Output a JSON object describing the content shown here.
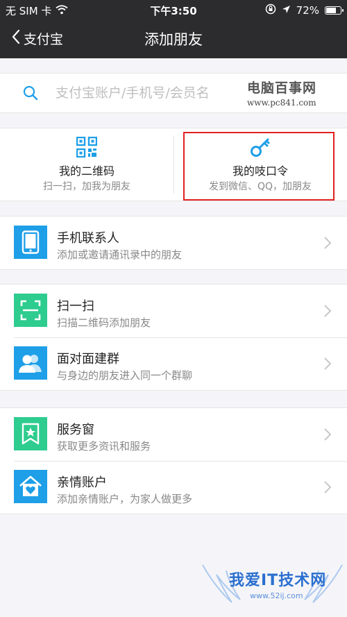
{
  "status_bar": {
    "carrier": "无 SIM 卡",
    "time": "下午3:50",
    "battery_text": "72%",
    "battery_level": 0.72
  },
  "nav": {
    "back_label": "支付宝",
    "title": "添加朋友"
  },
  "search": {
    "placeholder": "支付宝账户/手机号/会员名"
  },
  "watermark_top": {
    "title": "电脑百事网",
    "url": "www.pc841.com"
  },
  "cards": [
    {
      "title": "我的二维码",
      "subtitle": "扫一扫，加我为朋友",
      "icon": "qr-code-icon"
    },
    {
      "title": "我的吱口令",
      "subtitle": "发到微信、QQ，加朋友",
      "icon": "key-icon"
    }
  ],
  "groups": [
    {
      "items": [
        {
          "title": "手机联系人",
          "subtitle": "添加或邀请通讯录中的朋友",
          "icon": "phone-icon",
          "color": "#1e9fe8"
        }
      ]
    },
    {
      "items": [
        {
          "title": "扫一扫",
          "subtitle": "扫描二维码添加朋友",
          "icon": "scan-icon",
          "color": "#2ecc8f"
        },
        {
          "title": "面对面建群",
          "subtitle": "与身边的朋友进入同一个群聊",
          "icon": "group-icon",
          "color": "#1e9fe8"
        }
      ]
    },
    {
      "items": [
        {
          "title": "服务窗",
          "subtitle": "获取更多资讯和服务",
          "icon": "service-window-icon",
          "color": "#2ecc8f"
        },
        {
          "title": "亲情账户",
          "subtitle": "添加亲情账户，为家人做更多",
          "icon": "family-home-icon",
          "color": "#1e9fe8"
        }
      ]
    }
  ],
  "watermark_bottom": {
    "title": "我爱IT技术网",
    "url": "www.52ij.com"
  },
  "colors": {
    "accent_blue": "#1e9fe8",
    "accent_green": "#2ecc8f",
    "highlight_red": "#e02020",
    "topbar": "#2c2c2e"
  }
}
